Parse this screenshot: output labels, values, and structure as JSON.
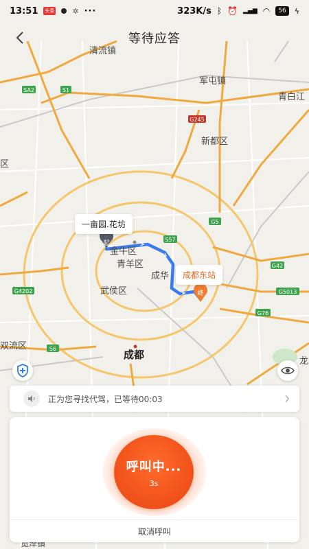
{
  "status_bar": {
    "time": "13:51",
    "badge": "头条",
    "more": "···",
    "network_speed": "323K/s",
    "battery": "56"
  },
  "nav": {
    "title": "等待应答",
    "back_icon": "chevron-left-icon"
  },
  "map": {
    "origin_label": "一亩园.花坊",
    "destination_label": "成都东站",
    "origin_marker": "起",
    "destination_marker": "终",
    "route_color": "#3a7bef",
    "place_names": {
      "qingliu": "清流镇",
      "juntun": "军屯镇",
      "qingbai": "青白江",
      "xindu": "新都区",
      "jinniu": "金牛区",
      "qingyang": "青羊区",
      "chenghua": "成华",
      "wuhou": "武侯区",
      "chengdu": "成都",
      "shuangliu": "双流区",
      "long": "龙",
      "qu": "区",
      "luoze": "览泽镇"
    },
    "highways": {
      "sa2": "SA2",
      "s1": "S1",
      "g245": "G245",
      "g5": "G5",
      "s57": "S57",
      "g42": "G42",
      "g4202": "G4202",
      "g5013": "G5013",
      "g76": "G76",
      "s6": "S6"
    }
  },
  "notice": {
    "text": "正为您寻找代驾，已等待00:03"
  },
  "call_panel": {
    "status": "呼叫中...",
    "seconds": "3s",
    "cancel_label": "取消呼叫"
  }
}
